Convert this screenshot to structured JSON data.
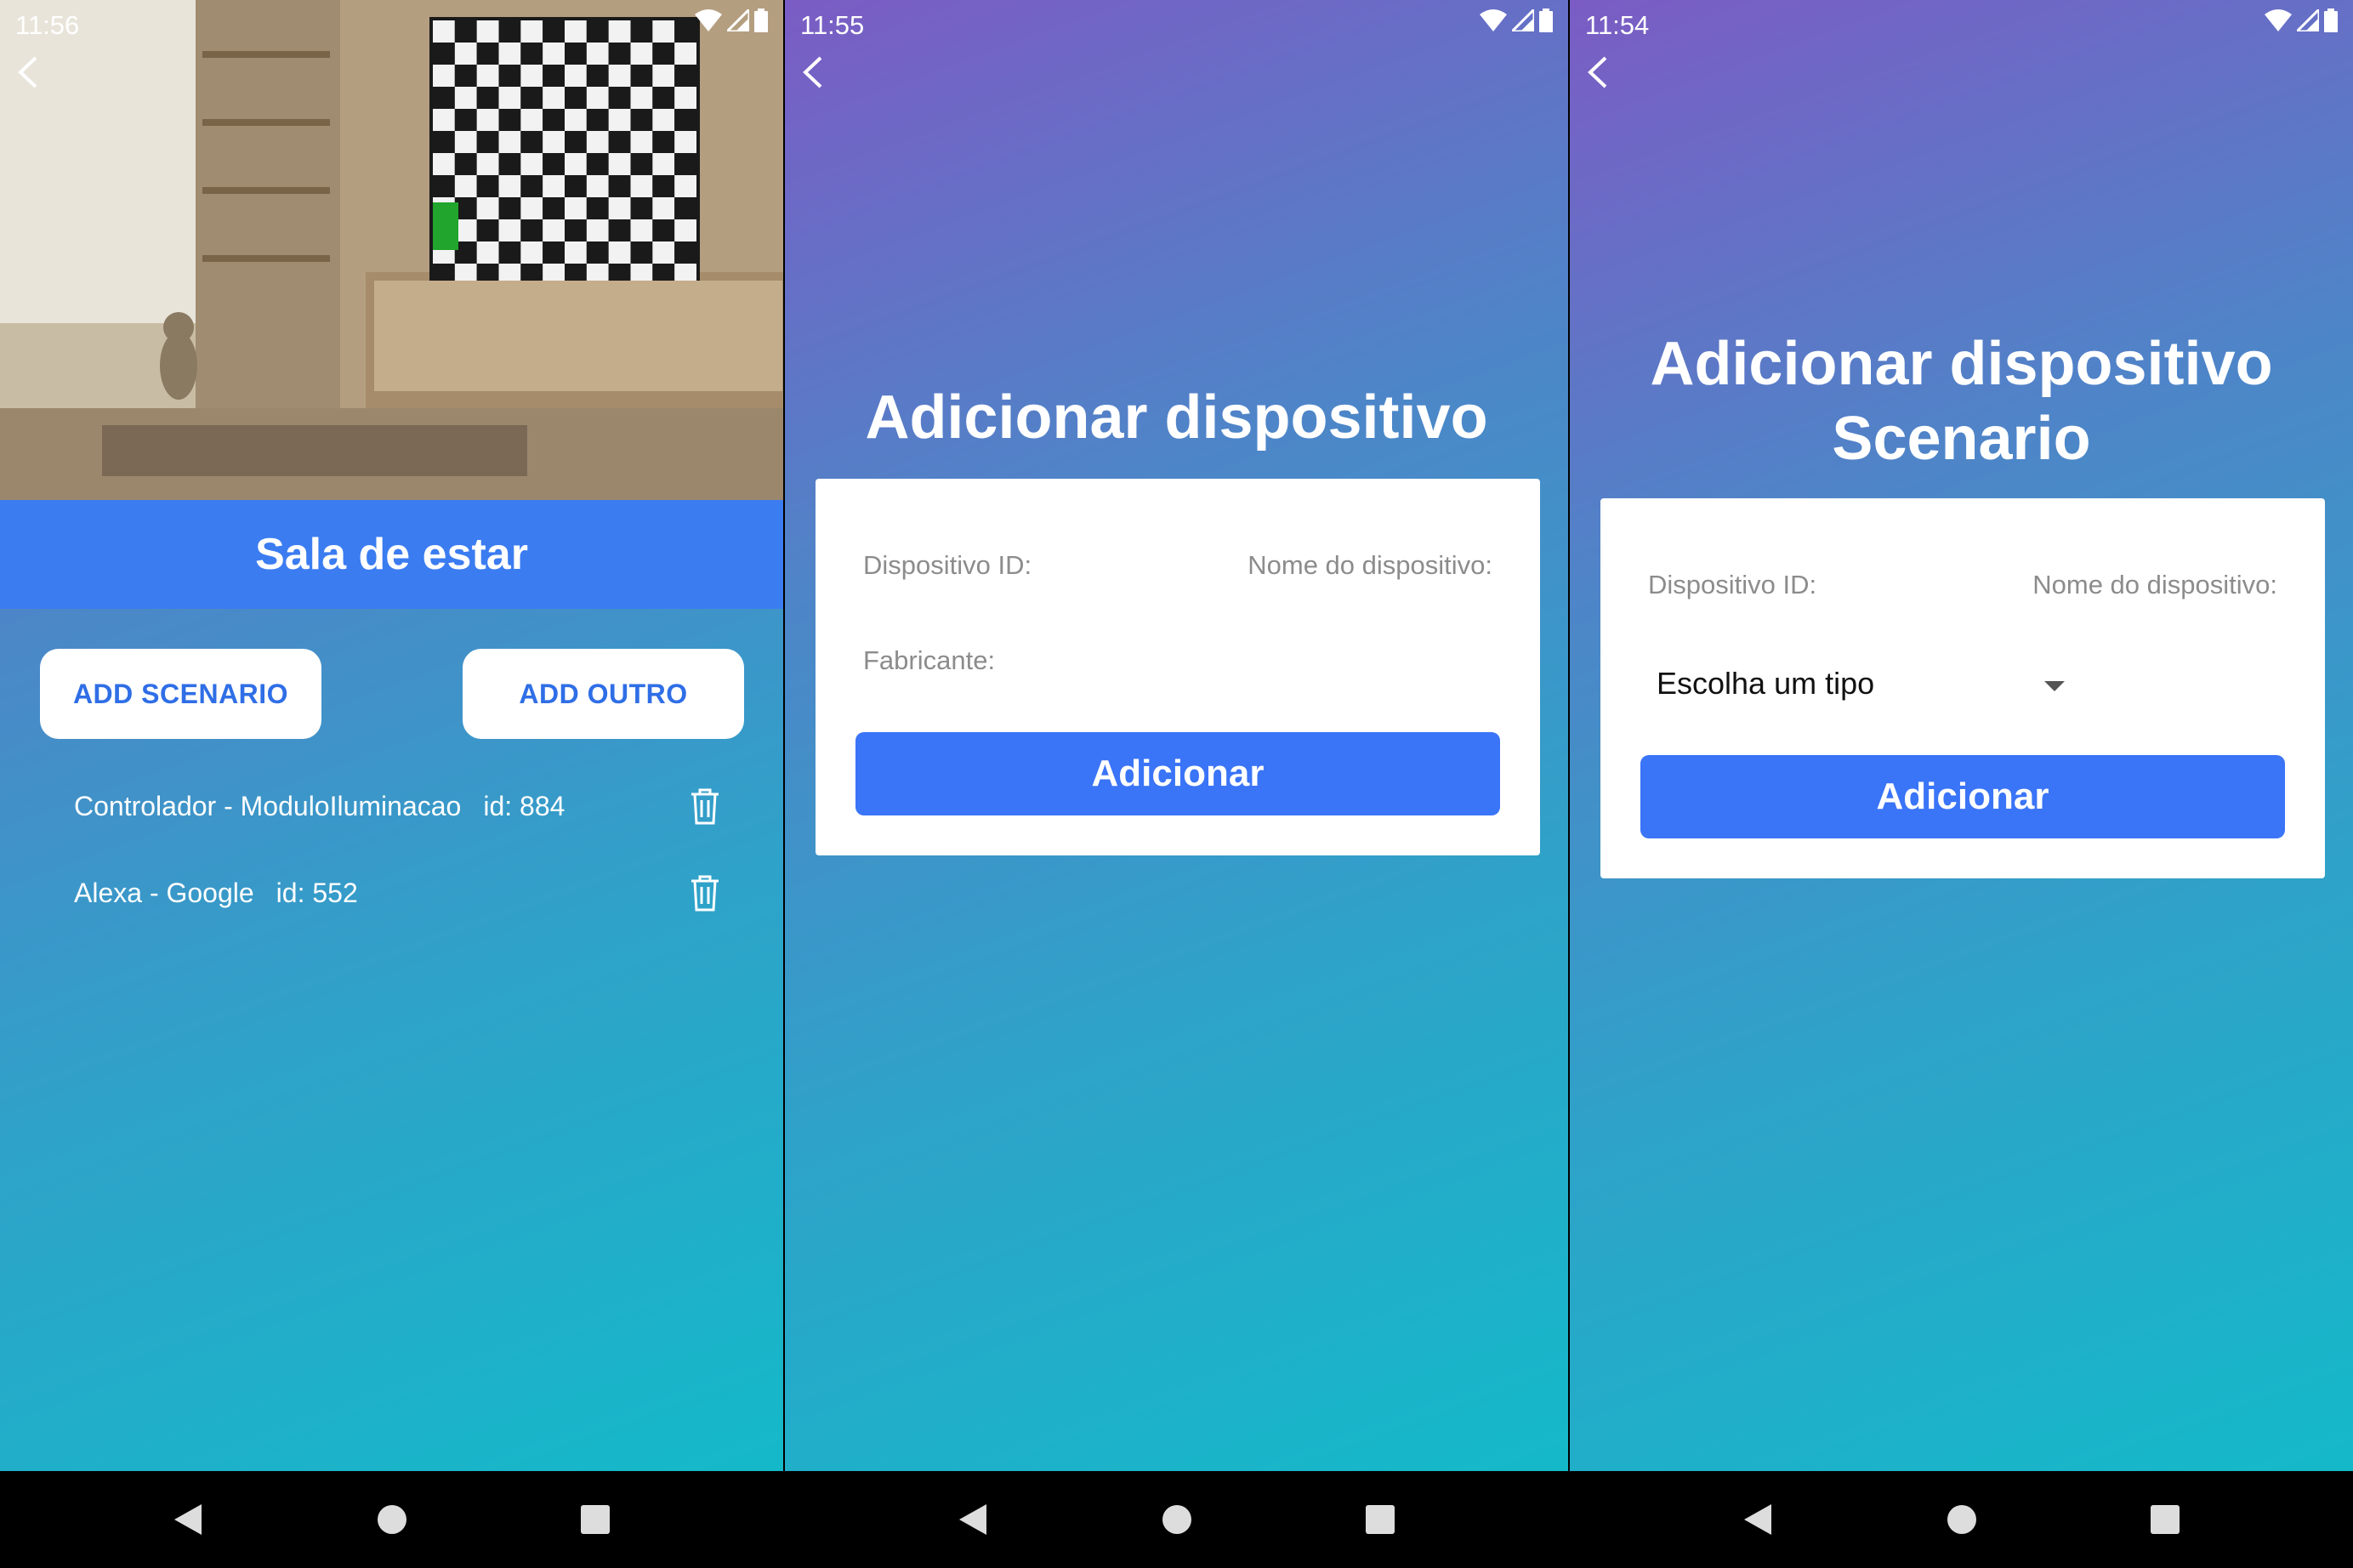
{
  "screens": {
    "room": {
      "time": "11:56",
      "header": "Sala de estar",
      "buttons": {
        "add_scenario": "ADD SCENARIO",
        "add_outro": "ADD OUTRO"
      },
      "devices": [
        {
          "name": "Controlador - ModuloIluminacao",
          "id": "id: 884"
        },
        {
          "name": "Alexa - Google",
          "id": "id: 552"
        }
      ]
    },
    "add_device": {
      "time": "11:55",
      "title": "Adicionar dispositivo",
      "fields": {
        "id": "Dispositivo ID:",
        "name": "Nome do dispositivo:",
        "manufacturer": "Fabricante:"
      },
      "submit": "Adicionar"
    },
    "add_scenario": {
      "time": "11:54",
      "title_line1": "Adicionar dispositivo",
      "title_line2": "Scenario",
      "fields": {
        "id": "Dispositivo ID:",
        "name": "Nome do dispositivo:"
      },
      "select_value": "Escolha um tipo",
      "submit": "Adicionar"
    }
  },
  "colors": {
    "header_blue": "#3b7cf1",
    "button_blue": "#3a74f7",
    "gradient_top": "#7b5cc4",
    "gradient_bottom": "#14b9c9"
  },
  "icons": {
    "back": "chevron-left-icon",
    "trash": "trash-icon",
    "wifi": "wifi-icon",
    "signal": "signal-icon",
    "battery": "battery-icon",
    "nav_back": "triangle-back-icon",
    "nav_home": "circle-home-icon",
    "nav_recents": "square-recents-icon"
  }
}
